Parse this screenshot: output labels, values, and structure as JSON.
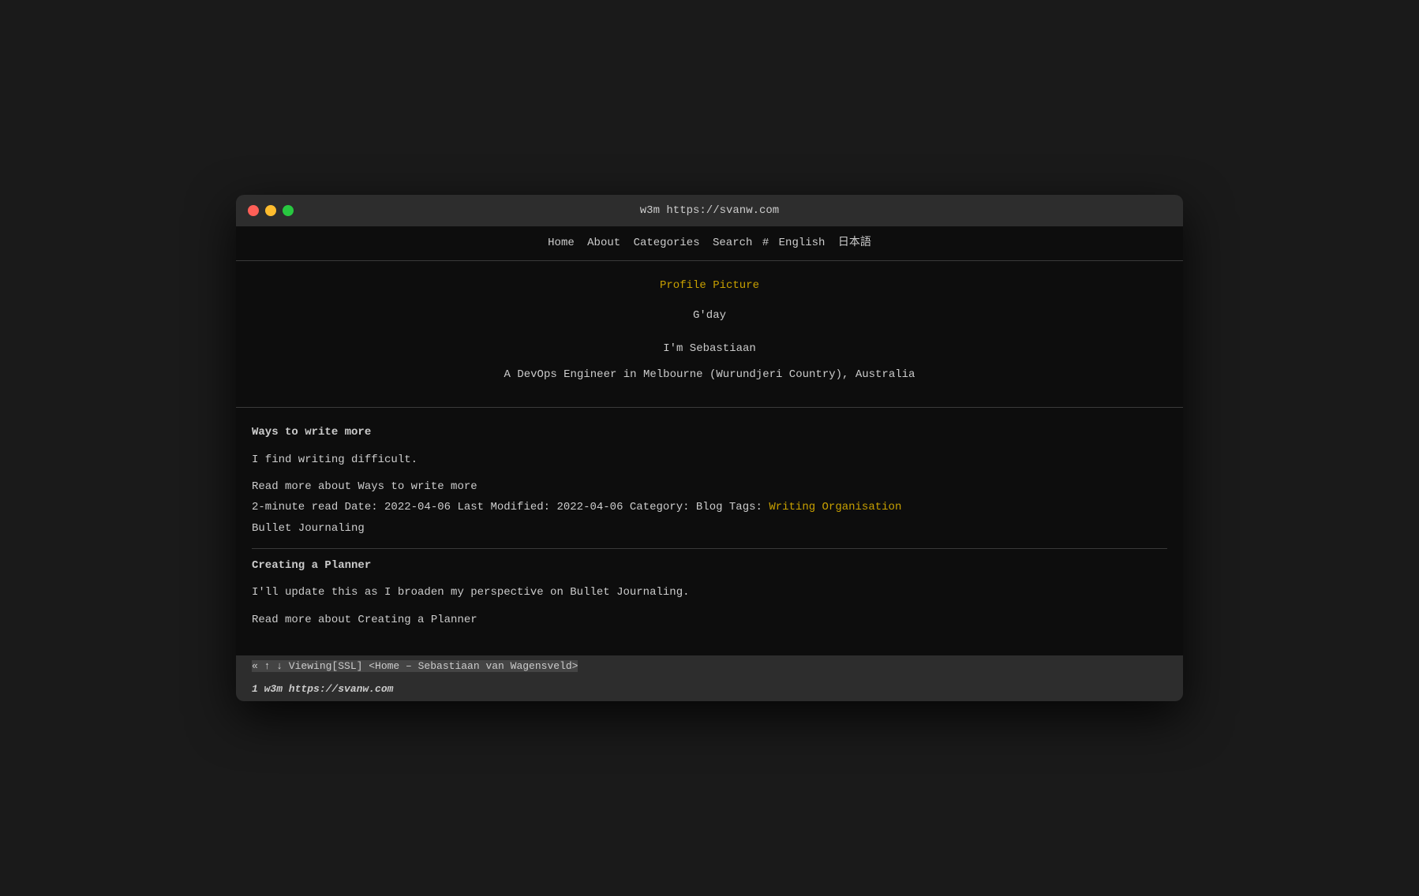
{
  "window": {
    "title": "w3m https://svanw.com"
  },
  "nav": {
    "home": "Home",
    "about": "About",
    "categories": "Categories",
    "search": "Search",
    "hash": "#",
    "english": "English",
    "japanese": "日本語"
  },
  "hero": {
    "profile_picture_label": "Profile Picture",
    "greeting": "G'day",
    "intro_line1": "I'm Sebastiaan",
    "intro_line2": "A DevOps Engineer in Melbourne (Wurundjeri Country), Australia"
  },
  "posts": [
    {
      "title": "Ways to write more",
      "excerpt": "I find writing difficult.",
      "read_more": "Read more about Ways to write more",
      "meta": "2-minute read Date: 2022-04-06 Last Modified: 2022-04-06 Category: Blog Tags:",
      "tags": "Writing Organisation",
      "extra_tags": "Bullet Journaling"
    },
    {
      "title": "Creating a Planner",
      "excerpt": "I'll update this as I broaden my perspective on Bullet Journaling.",
      "read_more": "Read more about Creating a Planner",
      "meta": "",
      "tags": "",
      "extra_tags": ""
    }
  ],
  "statusbar": {
    "text": "« ↑ ↓ Viewing[SSL] <Home – Sebastiaan van Wagensveld>"
  },
  "bottombar": {
    "text": "1 w3m https://svanw.com"
  }
}
